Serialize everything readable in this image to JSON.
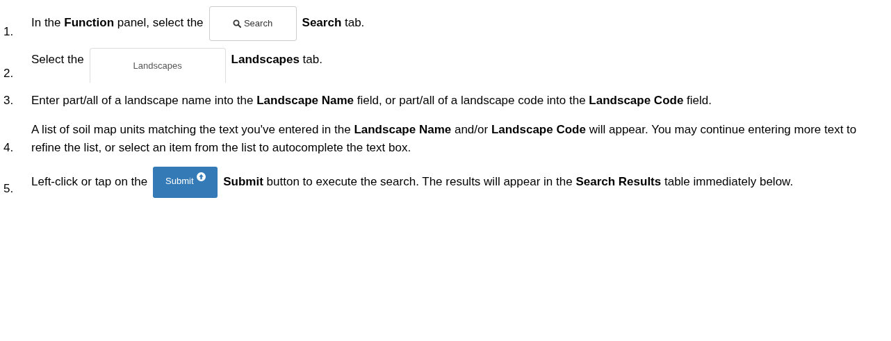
{
  "steps": [
    {
      "number": "1.",
      "parts": [
        {
          "kind": "text",
          "text": "In the **Function** panel, select the"
        },
        {
          "kind": "search-button",
          "text": "Search"
        },
        {
          "kind": "text",
          "text": "**Search** tab."
        }
      ]
    },
    {
      "number": "2.",
      "parts": [
        {
          "kind": "text",
          "text": "Select the"
        },
        {
          "kind": "tab",
          "text": "Landscapes"
        },
        {
          "kind": "text",
          "text": "**Landscapes** tab."
        }
      ]
    },
    {
      "number": "3.",
      "parts": [
        {
          "kind": "text",
          "text": "Enter part/all of a landscape name into the **Landscape Name** field, or part/all of a landscape code into the **Landscape Code** field."
        }
      ]
    },
    {
      "number": "4.",
      "parts": [
        {
          "kind": "text",
          "text": "A list of soil map units matching the text you've entered in the **Landscape Name** and/or **Landscape Code** will appear. You may continue entering more text to refine the list, or select an item from the list to autocomplete the text box."
        }
      ]
    },
    {
      "number": "5.",
      "parts": [
        {
          "kind": "text",
          "text": "Left-click or tap on the"
        },
        {
          "kind": "submit-button",
          "text": "Submit"
        },
        {
          "kind": "text",
          "text": "**Submit** button to execute the search. The results will appear in the **Search Results** table immediately below."
        }
      ]
    }
  ]
}
